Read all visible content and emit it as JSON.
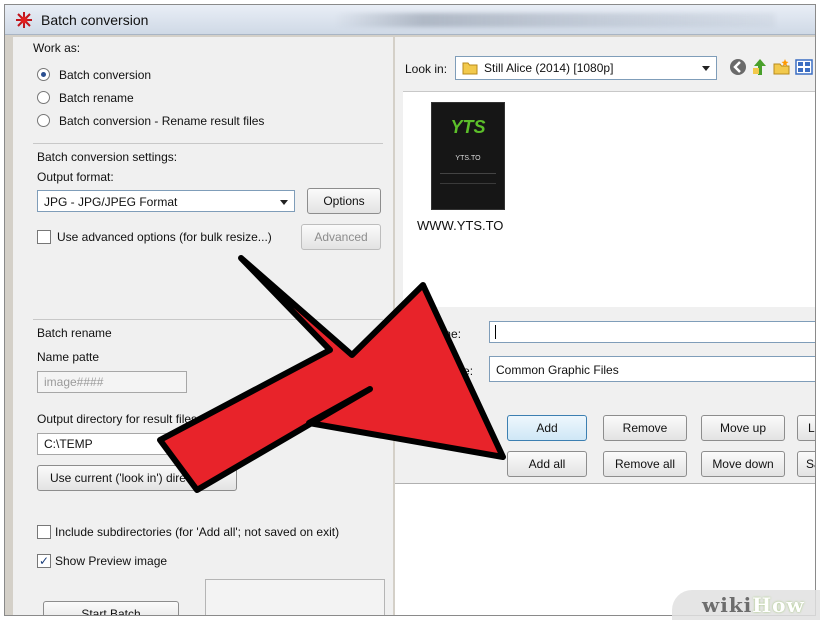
{
  "window": {
    "title": "Batch conversion"
  },
  "left": {
    "work_as_label": "Work as:",
    "radios": [
      {
        "label": "Batch conversion",
        "selected": true
      },
      {
        "label": "Batch rename",
        "selected": false
      },
      {
        "label": "Batch conversion - Rename result files",
        "selected": false
      }
    ],
    "conversion_settings_label": "Batch conversion settings:",
    "output_format_label": "Output format:",
    "output_format_value": "JPG - JPG/JPEG Format",
    "options_button": "Options",
    "advanced_check_label": "Use advanced options (for bulk resize...)",
    "advanced_check": false,
    "advanced_button": "Advanced",
    "rename_label": "Batch rename",
    "name_pattern_label": "Name patte",
    "name_pattern_value": "image####",
    "output_dir_label": "Output directory for result files:",
    "output_dir_value": "C:\\TEMP",
    "use_current_button": "Use current ('look in') direct",
    "include_subdirs_label": "Include subdirectories (for 'Add all'; not saved on exit)",
    "include_subdirs": false,
    "show_preview_label": "Show Preview image",
    "show_preview": true,
    "start_batch_button": "Start Batch"
  },
  "right": {
    "look_in_label": "Look in:",
    "look_in_value": "Still Alice (2014) [1080p]",
    "toolbar_icons": [
      "back-icon",
      "up-folder-icon",
      "new-folder-icon",
      "view-menu-icon"
    ],
    "file_item": {
      "name": "WWW.YTS.TO",
      "thumb_logo": "YTS",
      "thumb_sub": "YTS.TO"
    },
    "file_name_label": "File name:",
    "file_name_value": "",
    "files_of_type_label": "Files of type:",
    "files_of_type_value": "Common Graphic Files",
    "buttons_row1": [
      "Add",
      "Remove",
      "Move up",
      "Lo"
    ],
    "buttons_row2": [
      "Add all",
      "Remove all",
      "Move down",
      "Sav"
    ]
  },
  "watermark": {
    "wiki": "wiki",
    "how": "How"
  },
  "colors": {
    "arrow_red": "#e8232a",
    "arrow_outline": "#000000",
    "accent_blue": "#3c7fb1"
  }
}
